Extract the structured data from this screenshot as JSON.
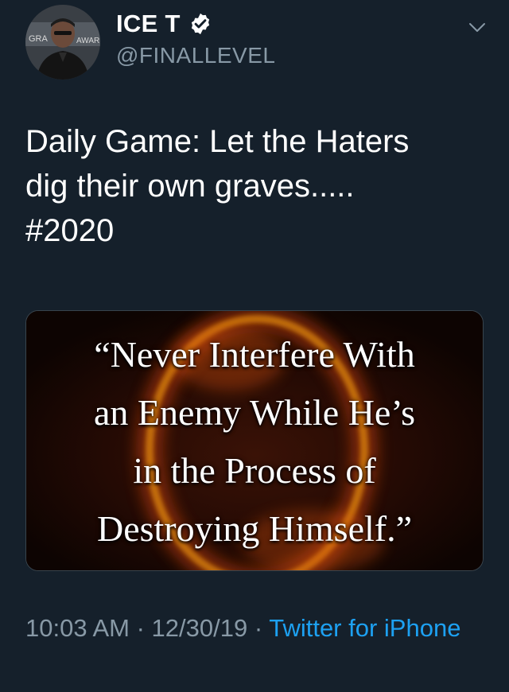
{
  "author": {
    "display_name": "ICE T",
    "handle": "@FINALLEVEL",
    "avatar_backdrop_text": [
      "GRA",
      "AWAR"
    ],
    "verified": true
  },
  "tweet": {
    "text": "Daily Game: Let the Haters\ndig their own graves.....\n#2020"
  },
  "media": {
    "quote_lines": [
      "“Never Interfere With",
      "an Enemy While He’s",
      "in the Process of",
      "Destroying Himself.”"
    ]
  },
  "meta": {
    "time": "10:03 AM",
    "separator1": " · ",
    "date": "12/30/19",
    "separator2": " · ",
    "source": "Twitter for iPhone"
  },
  "icons": {
    "verified": "verified-badge-icon",
    "menu": "chevron-down-icon"
  },
  "colors": {
    "background": "#15202b",
    "secondary_text": "#8899a6",
    "link": "#1da1f2",
    "fire": "#e0641a"
  }
}
